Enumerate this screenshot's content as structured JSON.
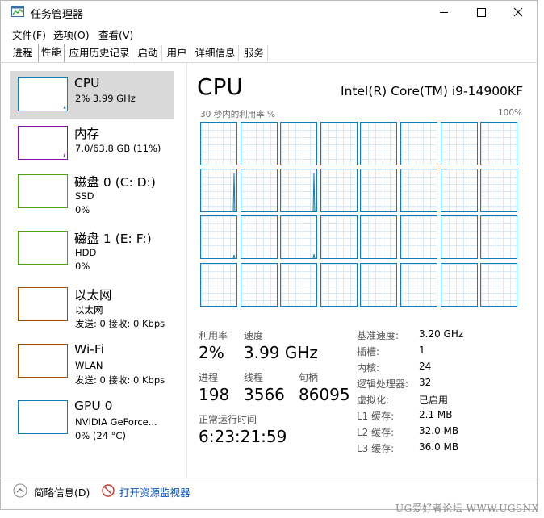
{
  "window": {
    "title": "任务管理器"
  },
  "menus": [
    "文件(F)",
    "选项(O)",
    "查看(V)"
  ],
  "tabs": [
    "进程",
    "性能",
    "应用历史记录",
    "启动",
    "用户",
    "详细信息",
    "服务"
  ],
  "active_tab": "性能",
  "sidebar": {
    "items": [
      {
        "title": "CPU",
        "line1": "2% 3.99 GHz",
        "line2": "",
        "color": "#117dbb"
      },
      {
        "title": "内存",
        "line1": "7.0/63.8 GB (11%)",
        "line2": "",
        "color": "#8b12ae"
      },
      {
        "title": "磁盘 0 (C: D:)",
        "line1": "SSD",
        "line2": "0%",
        "color": "#4da60c"
      },
      {
        "title": "磁盘 1 (E: F:)",
        "line1": "HDD",
        "line2": "0%",
        "color": "#4da60c"
      },
      {
        "title": "以太网",
        "line1": "以太网",
        "line2": "发送: 0 接收: 0 Kbps",
        "color": "#a74f01"
      },
      {
        "title": "Wi-Fi",
        "line1": "WLAN",
        "line2": "发送: 0 接收: 0 Kbps",
        "color": "#a74f01"
      },
      {
        "title": "GPU 0",
        "line1": "NVIDIA GeForce...",
        "line2": "0% (24 °C)",
        "color": "#117dbb"
      }
    ]
  },
  "cpu": {
    "heading": "CPU",
    "model": "Intel(R) Core(TM) i9-14900KF",
    "graph_label": "30 秒内的利用率 %",
    "graph_max": "100%",
    "core_spikes": [
      [
        0,
        0,
        0,
        0,
        0,
        0,
        0,
        0
      ],
      [
        0.95,
        0,
        0.95,
        0,
        0,
        0,
        0,
        0
      ],
      [
        0.08,
        0,
        0.1,
        0,
        0,
        0,
        0,
        0
      ],
      [
        0,
        0,
        0,
        0,
        0,
        0,
        0,
        0
      ]
    ],
    "stats": {
      "utilization_label": "利用率",
      "utilization": "2%",
      "speed_label": "速度",
      "speed": "3.99 GHz",
      "processes_label": "进程",
      "processes": "198",
      "threads_label": "线程",
      "threads": "3566",
      "handles_label": "句柄",
      "handles": "86095",
      "uptime_label": "正常运行时间",
      "uptime": "6:23:21:59"
    },
    "specs": [
      {
        "label": "基准速度:",
        "value": "3.20 GHz"
      },
      {
        "label": "插槽:",
        "value": "1"
      },
      {
        "label": "内核:",
        "value": "24"
      },
      {
        "label": "逻辑处理器:",
        "value": "32"
      },
      {
        "label": "虚拟化:",
        "value": "已启用"
      },
      {
        "label": "L1 缓存:",
        "value": "2.1 MB"
      },
      {
        "label": "L2 缓存:",
        "value": "32.0 MB"
      },
      {
        "label": "L3 缓存:",
        "value": "36.0 MB"
      }
    ]
  },
  "footer": {
    "fewer_details": "简略信息(D)",
    "open_monitor": "打开资源监视器"
  },
  "watermark": "UG爱好者论坛 WWW.UGSNX.COM"
}
